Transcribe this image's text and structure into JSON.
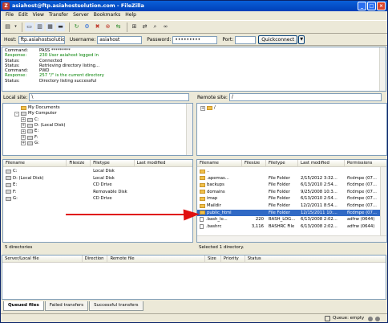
{
  "window": {
    "title": "asiahost@ftp.asiahostsolution.com - FileZilla",
    "app_icon": "filezilla-icon",
    "controls": [
      "minimize",
      "maximize",
      "close"
    ]
  },
  "menu": [
    "File",
    "Edit",
    "View",
    "Transfer",
    "Server",
    "Bookmarks",
    "Help"
  ],
  "quickconnect": {
    "host_label": "Host:",
    "host_value": "ftp.asiahostsolution.",
    "username_label": "Username:",
    "username_value": "asiahost",
    "password_label": "Password:",
    "password_value": "•••••••••",
    "port_label": "Port:",
    "port_value": "",
    "button": "Quickconnect"
  },
  "log": [
    {
      "label": "Command:",
      "msg": "PASS *********",
      "color": "#000000"
    },
    {
      "label": "Response:",
      "msg": "230 User asiahost logged in",
      "color": "#008000"
    },
    {
      "label": "Status:",
      "msg": "Connected",
      "color": "#000000"
    },
    {
      "label": "Status:",
      "msg": "Retrieving directory listing...",
      "color": "#000000"
    },
    {
      "label": "Command:",
      "msg": "PWD",
      "color": "#000000"
    },
    {
      "label": "Response:",
      "msg": "257 \"/\" is the current directory",
      "color": "#008000"
    },
    {
      "label": "Status:",
      "msg": "Directory listing successful",
      "color": "#000000"
    }
  ],
  "local": {
    "site_label": "Local site:",
    "site_value": "\\",
    "tree": [
      {
        "label": "My Documents",
        "icon": "folder",
        "expander": ""
      },
      {
        "label": "My Computer",
        "icon": "computer",
        "expander": "-"
      },
      {
        "label": "C:",
        "icon": "drive",
        "expander": "+"
      },
      {
        "label": "D: (Local Disk)",
        "icon": "drive",
        "expander": "+"
      },
      {
        "label": "E:",
        "icon": "drive",
        "expander": "+"
      },
      {
        "label": "F:",
        "icon": "drive",
        "expander": "+"
      },
      {
        "label": "G:",
        "icon": "drive",
        "expander": "+"
      }
    ],
    "columns": [
      "Filename",
      "Filesize",
      "Filetype",
      "Last modified"
    ],
    "files": [
      {
        "name": "C:",
        "size": "",
        "type": "Local Disk",
        "modified": ""
      },
      {
        "name": "D: (Local Disk)",
        "size": "",
        "type": "Local Disk",
        "modified": ""
      },
      {
        "name": "E:",
        "size": "",
        "type": "CD Drive",
        "modified": ""
      },
      {
        "name": "F:",
        "size": "",
        "type": "Removable Disk",
        "modified": ""
      },
      {
        "name": "G:",
        "size": "",
        "type": "CD Drive",
        "modified": ""
      }
    ],
    "status": "5 directories"
  },
  "remote": {
    "site_label": "Remote site:",
    "site_value": "/",
    "tree": [
      {
        "label": "/",
        "icon": "folder",
        "expander": "+"
      }
    ],
    "columns": [
      "Filename",
      "Filesize",
      "Filetype",
      "Last modified",
      "Permissions"
    ],
    "files": [
      {
        "name": "..",
        "size": "",
        "type": "",
        "modified": "",
        "perms": "",
        "selected": false
      },
      {
        "name": ".apemas...",
        "size": "",
        "type": "File Folder",
        "modified": "2/15/2012 3:32...",
        "perms": "flcdmpe (07...",
        "selected": false
      },
      {
        "name": "backups",
        "size": "",
        "type": "File Folder",
        "modified": "6/13/2010 2:54...",
        "perms": "flcdmpe (07...",
        "selected": false
      },
      {
        "name": "domains",
        "size": "",
        "type": "File Folder",
        "modified": "9/25/2008 10:3...",
        "perms": "flcdmpe (07...",
        "selected": false
      },
      {
        "name": "imap",
        "size": "",
        "type": "File Folder",
        "modified": "6/13/2010 2:54...",
        "perms": "flcdmpe (07...",
        "selected": false
      },
      {
        "name": "Maildir",
        "size": "",
        "type": "File Folder",
        "modified": "12/2/2011 8:54...",
        "perms": "flcdmpe (07...",
        "selected": false
      },
      {
        "name": "public_html",
        "size": "",
        "type": "File Folder",
        "modified": "12/15/2011 10:...",
        "perms": "flcdmpe (07...",
        "selected": true
      },
      {
        "name": ".bash_lo...",
        "size": "220",
        "type": "BASH_LOG...",
        "modified": "6/13/2008 2:02...",
        "perms": "adfrw (0644)",
        "selected": false
      },
      {
        "name": ".bashrc",
        "size": "3,116",
        "type": "BASHRC File",
        "modified": "6/13/2008 2:02...",
        "perms": "adfrw (0644)",
        "selected": false
      }
    ],
    "status": "Selected 1 directory."
  },
  "queue": {
    "columns": [
      "Server/Local file",
      "Direction",
      "Remote file",
      "Size",
      "Priority",
      "Status"
    ]
  },
  "tabs": [
    "Queued files",
    "Failed transfers",
    "Successful transfers"
  ],
  "statusbar": {
    "queue": "Queue: empty"
  },
  "annotation": {
    "color": "#e01010"
  }
}
